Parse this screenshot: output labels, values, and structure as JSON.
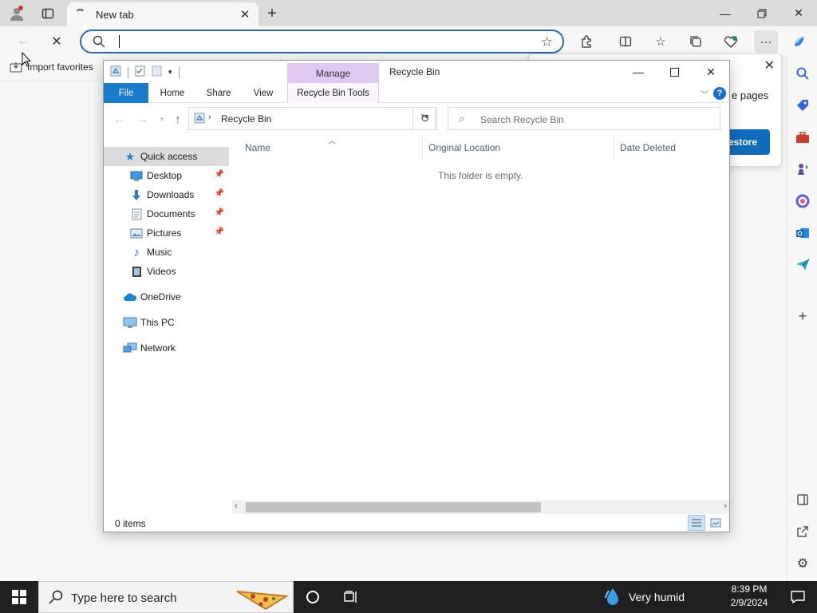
{
  "browser": {
    "tab_title": "New tab",
    "address_value": "",
    "favorites_bar": {
      "import_label": "Import favorites"
    }
  },
  "popup": {
    "text": "e pages",
    "button_label": "estore"
  },
  "explorer": {
    "title": "Recycle Bin",
    "context_tab": "Manage",
    "ribbon_tabs": [
      "File",
      "Home",
      "Share",
      "View",
      "Recycle Bin Tools"
    ],
    "address_crumb": "Recycle Bin",
    "search_placeholder": "Search Recycle Bin",
    "columns": [
      "Name",
      "Original Location",
      "Date Deleted"
    ],
    "empty_message": "This folder is empty.",
    "status": "0 items",
    "nav": {
      "quick_access": "Quick access",
      "items": [
        "Desktop",
        "Downloads",
        "Documents",
        "Pictures",
        "Music",
        "Videos"
      ],
      "onedrive": "OneDrive",
      "this_pc": "This PC",
      "network": "Network"
    }
  },
  "taskbar": {
    "search_placeholder": "Type here to search",
    "weather": "Very humid",
    "time": "8:39 PM",
    "date": "2/9/2024"
  },
  "colors": {
    "accent": "#1979ca",
    "manage_tab": "#e1c8f0",
    "address_focus": "#2b66c4",
    "taskbar": "#202020"
  }
}
